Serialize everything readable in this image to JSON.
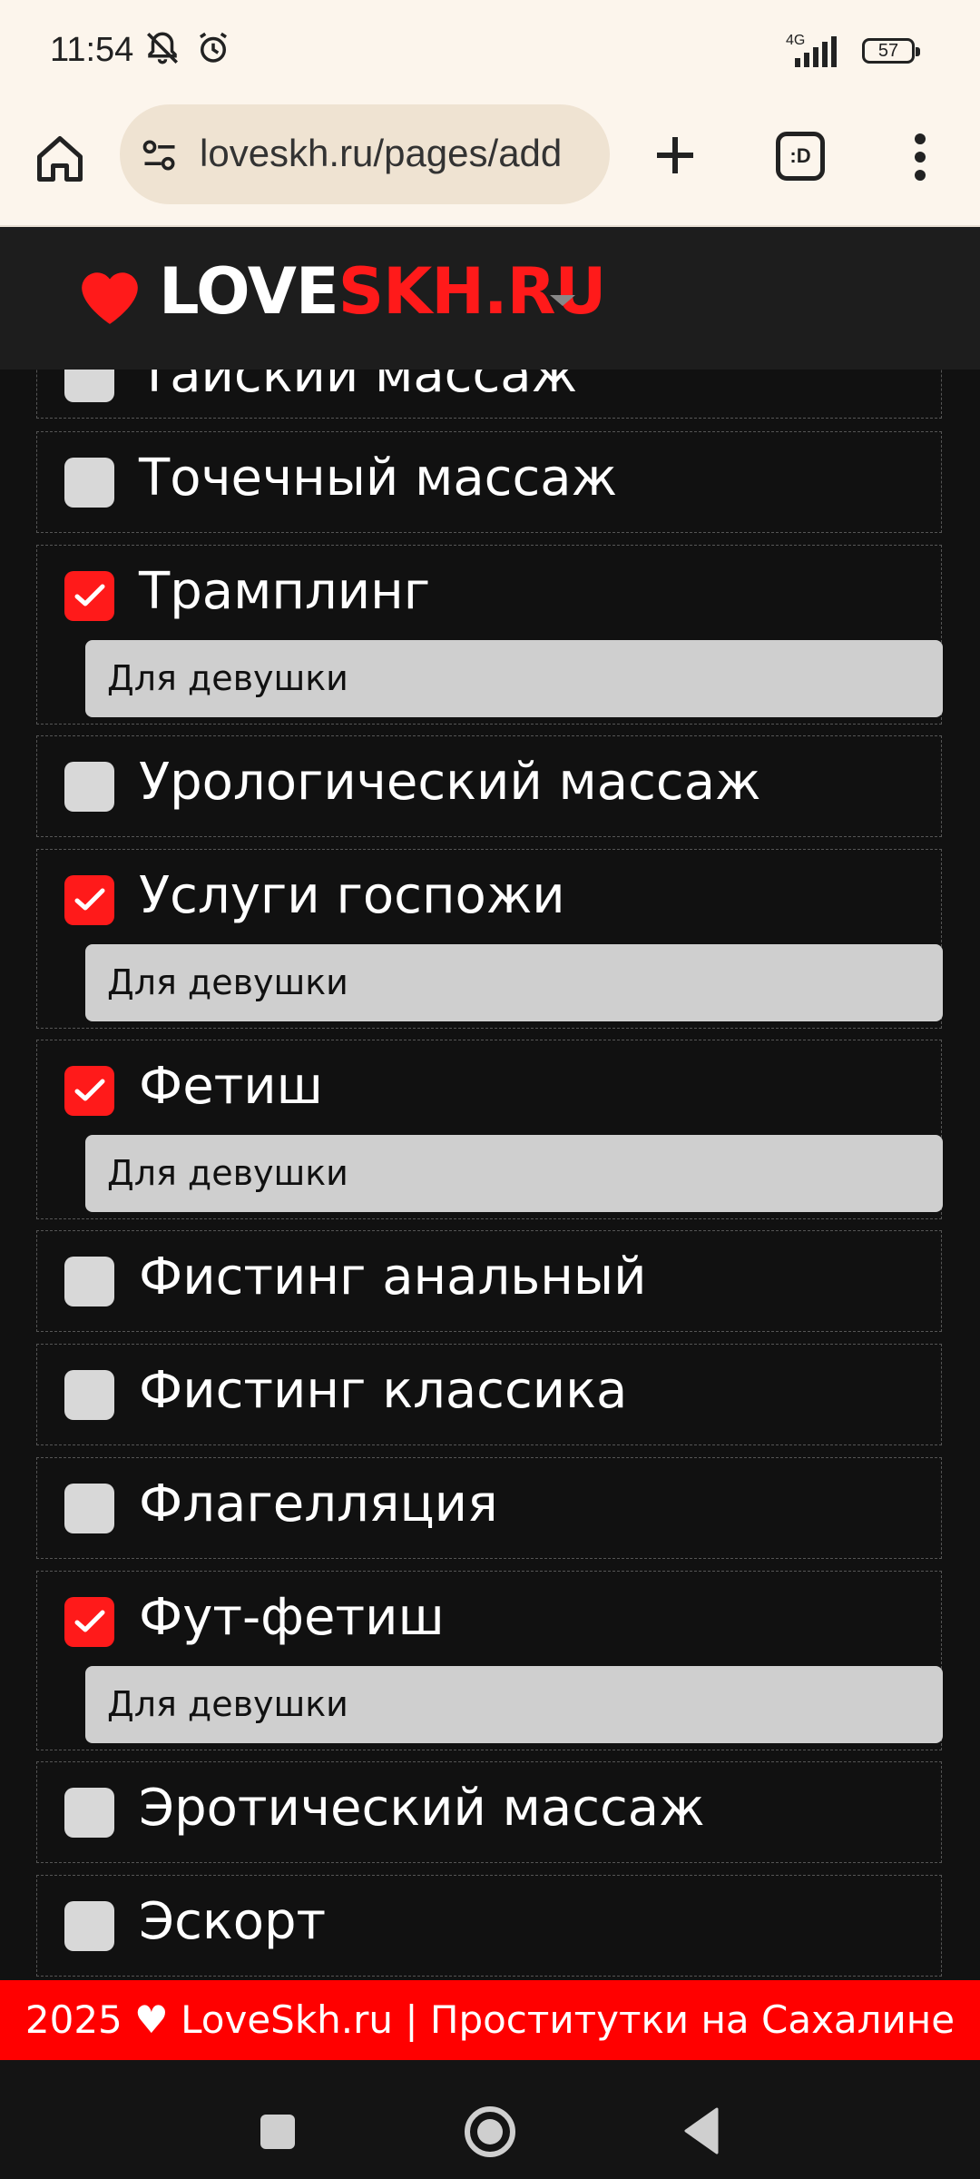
{
  "status_bar": {
    "time": "11:54",
    "network": "4G",
    "battery": "57",
    "icons": [
      "bell-off-icon",
      "alarm-clock-icon",
      "signal-bars-icon",
      "battery-icon"
    ]
  },
  "browser": {
    "url": "loveskh.ru/pages/add",
    "tabs_label": ":D",
    "icons": [
      "home-icon",
      "site-settings-icon",
      "new-tab-plus-icon",
      "tab-switcher-icon",
      "more-vert-icon"
    ]
  },
  "site": {
    "logo_part1": "LOVE",
    "logo_part2": "SKH.RU",
    "logo_icon": "heart-icon"
  },
  "colors": {
    "accent": "#ff1a1a",
    "background": "#111111",
    "header": "#1d1d1d",
    "footer": "#ff0000",
    "select_bg": "#cfcfcf"
  },
  "services": [
    {
      "label": "Тайский массаж",
      "checked": false
    },
    {
      "label": "Точечный массаж",
      "checked": false
    },
    {
      "label": "Трамплинг",
      "checked": true,
      "select": "Для девушки"
    },
    {
      "label": "Урологический массаж",
      "checked": false
    },
    {
      "label": "Услуги госпожи",
      "checked": true,
      "select": "Для девушки"
    },
    {
      "label": "Фетиш",
      "checked": true,
      "select": "Для девушки"
    },
    {
      "label": "Фистинг анальный",
      "checked": false
    },
    {
      "label": "Фистинг классика",
      "checked": false
    },
    {
      "label": "Флагелляция",
      "checked": false
    },
    {
      "label": "Фут-фетиш",
      "checked": true,
      "select": "Для девушки"
    },
    {
      "label": "Эротический массаж",
      "checked": false
    },
    {
      "label": "Эскорт",
      "checked": false
    }
  ],
  "footer": {
    "text": "2025 ♥ LoveSkh.ru | Проститутки на Сахалине"
  },
  "nav": {
    "icons": [
      "recents-square-icon",
      "home-circle-icon",
      "back-triangle-icon"
    ]
  }
}
